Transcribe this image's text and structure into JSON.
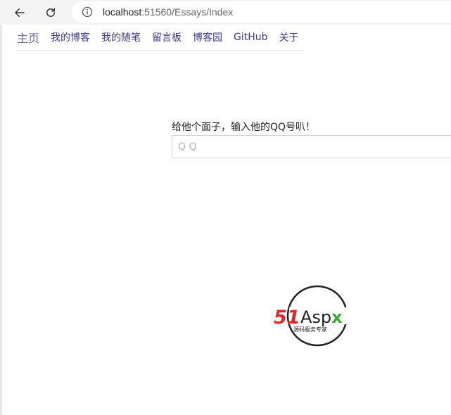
{
  "browser": {
    "url_host": "localhost",
    "url_rest": ":51560/Essays/Index"
  },
  "nav": {
    "items": [
      {
        "label": "主页"
      },
      {
        "label": "我的博客"
      },
      {
        "label": "我的随笔"
      },
      {
        "label": "留言板"
      },
      {
        "label": "博客园"
      },
      {
        "label": "GitHub"
      },
      {
        "label": "关于"
      }
    ]
  },
  "form": {
    "label": "给他个面子，输入他的QQ号叭！",
    "qq_placeholder": "Q Q",
    "qq_value": ""
  },
  "logo": {
    "brand_num": "51",
    "brand_text": "Aspx",
    "tagline": "源码服务专家"
  },
  "colors": {
    "nav_link": "#3b3b87",
    "logo_red": "#e8232a",
    "logo_green": "#3aa635"
  }
}
